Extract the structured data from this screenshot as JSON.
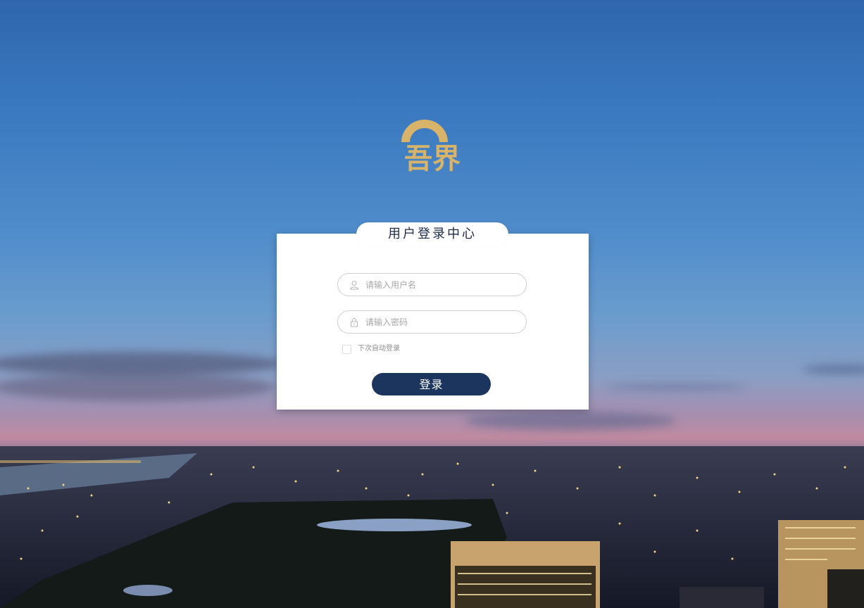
{
  "brand": {
    "logo_text": "吾界",
    "logo_color": "#d7b46a"
  },
  "login_card": {
    "title": "用户登录中心",
    "username": {
      "placeholder": "请输入用户名",
      "value": "",
      "icon": "user-icon"
    },
    "password": {
      "placeholder": "请输入密码",
      "value": "",
      "icon": "lock-icon"
    },
    "remember_me": {
      "label": "下次自动登录",
      "checked": false
    },
    "submit_label": "登录",
    "button_color": "#1b355f"
  },
  "background": {
    "description_icon": "city-night-skyline-image"
  }
}
